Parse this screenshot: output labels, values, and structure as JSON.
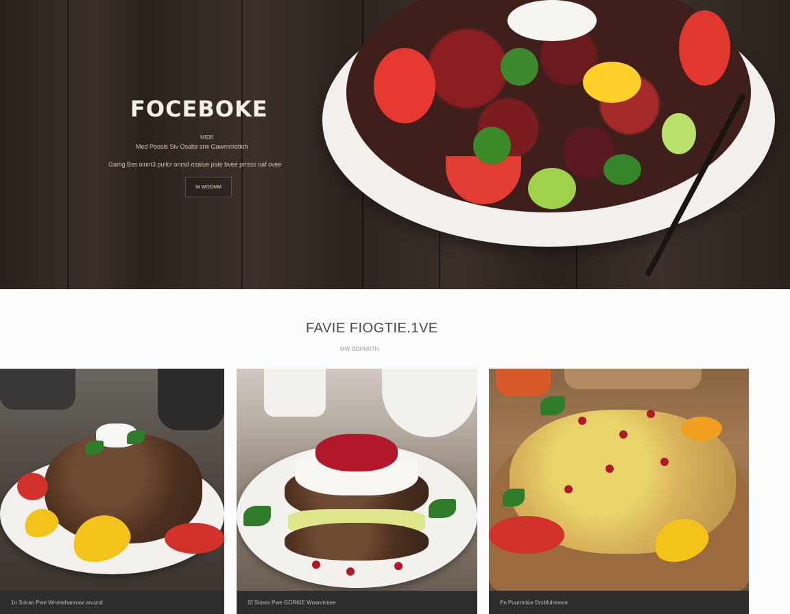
{
  "hero": {
    "brand": "FOCEBOKE",
    "tag": "MIDE",
    "line1": "Med Poosis Siv Osalte srw Gawrnrnotioh",
    "line2": "Gamg Bss oinnt3 pullcr onrsd osalue paie bvee prrsss oaf ovee",
    "button": "W WOOMM"
  },
  "section": {
    "title": "FAVIE FIOGTIE.1VE",
    "subtitle": "MW OOPHRTH"
  },
  "cards": [
    {
      "caption": "1n Soiran Pwe Wnmwhannaw aruund"
    },
    {
      "caption": "Sf Stoars Pwe GORKIE Woanmisee"
    },
    {
      "caption": "Pn Puurmdoe Drsbfulreasre"
    }
  ]
}
